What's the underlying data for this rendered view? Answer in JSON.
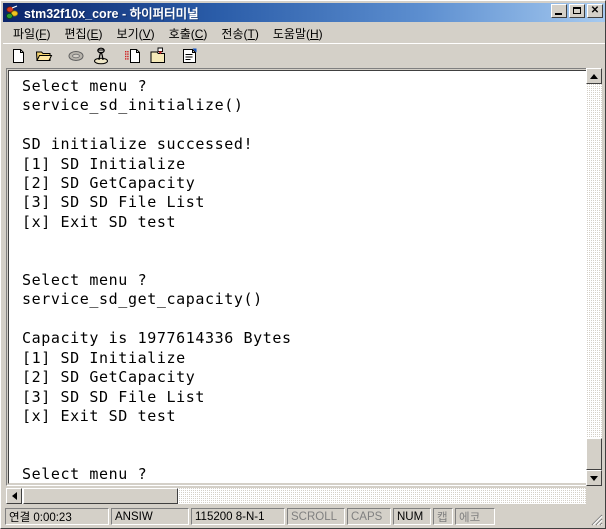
{
  "window": {
    "title": "stm32f10x_core - 하이퍼터미널",
    "icon": "hyperterminal-icon",
    "minimize_label": "_",
    "maximize_label": "□",
    "close_label": "✕"
  },
  "menubar": {
    "items": [
      {
        "name": "file",
        "text": "파일",
        "accel": "F"
      },
      {
        "name": "edit",
        "text": "편집",
        "accel": "E"
      },
      {
        "name": "view",
        "text": "보기",
        "accel": "V"
      },
      {
        "name": "call",
        "text": "호출",
        "accel": "C"
      },
      {
        "name": "transfer",
        "text": "전송",
        "accel": "T"
      },
      {
        "name": "help",
        "text": "도움말",
        "accel": "H"
      }
    ]
  },
  "toolbar": {
    "buttons": [
      {
        "name": "new-connection-icon",
        "tooltip": "새 연결"
      },
      {
        "name": "open-folder-icon",
        "tooltip": "열기"
      },
      {
        "name": "disconnect-phone-icon",
        "tooltip": "연결 끊기"
      },
      {
        "name": "call-phone-icon",
        "tooltip": "전화 걸기"
      },
      {
        "name": "send-file-icon",
        "tooltip": "보내기"
      },
      {
        "name": "receive-file-icon",
        "tooltip": "받기"
      },
      {
        "name": "properties-icon",
        "tooltip": "속성"
      }
    ]
  },
  "terminal": {
    "lines": [
      "Select menu ?",
      "service_sd_initialize()",
      "",
      "SD initialize successed!",
      "[1] SD Initialize",
      "[2] SD GetCapacity",
      "[3] SD SD File List",
      "[x] Exit SD test",
      "",
      "",
      "Select menu ?",
      "service_sd_get_capacity()",
      "",
      "Capacity is 1977614336 Bytes",
      "[1] SD Initialize",
      "[2] SD GetCapacity",
      "[3] SD SD File List",
      "[x] Exit SD test",
      "",
      "",
      "Select menu ?"
    ],
    "text": "Select menu ?\nservice_sd_initialize()\n\nSD initialize successed!\n[1] SD Initialize\n[2] SD GetCapacity\n[3] SD SD File List\n[x] Exit SD test\n\n\nSelect menu ?\nservice_sd_get_capacity()\n\nCapacity is 1977614336 Bytes\n[1] SD Initialize\n[2] SD GetCapacity\n[3] SD SD File List\n[x] Exit SD test\n\n\nSelect menu ?",
    "background": "#ffffff",
    "foreground": "#000000"
  },
  "statusbar": {
    "connection": "연결 0:00:23",
    "emulation": "ANSIW",
    "line_settings": "115200 8-N-1",
    "scroll": "SCROLL",
    "caps": "CAPS",
    "num": "NUM",
    "capture": "캡",
    "echo": "에코"
  },
  "colors": {
    "window_face": "#d4d0c8",
    "title_start": "#0a246a",
    "title_end": "#a6caf0",
    "terminal_bg": "#ffffff",
    "terminal_fg": "#000000"
  }
}
